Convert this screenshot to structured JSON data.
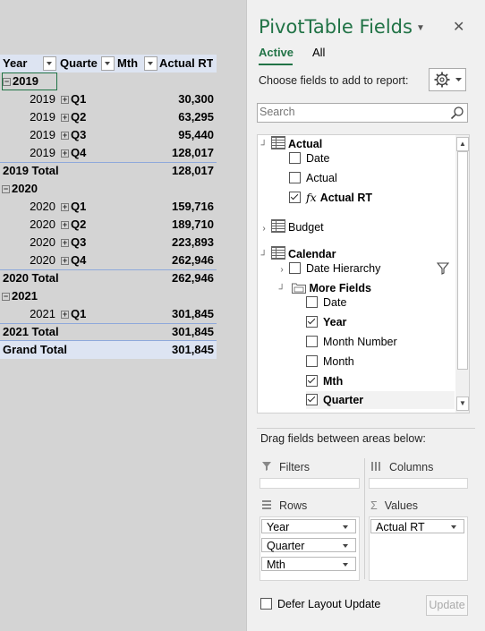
{
  "pivot": {
    "headers": [
      "Year",
      "Quarte",
      "Mth",
      "Actual RT"
    ],
    "rows": [
      {
        "type": "group",
        "label": "2019"
      },
      {
        "type": "detail",
        "year": "2019",
        "quarter": "Q1",
        "value": "30,300"
      },
      {
        "type": "detail",
        "year": "2019",
        "quarter": "Q2",
        "value": "63,295"
      },
      {
        "type": "detail",
        "year": "2019",
        "quarter": "Q3",
        "value": "95,440"
      },
      {
        "type": "detail",
        "year": "2019",
        "quarter": "Q4",
        "value": "128,017"
      },
      {
        "type": "total",
        "label": "2019 Total",
        "value": "128,017"
      },
      {
        "type": "group",
        "label": "2020"
      },
      {
        "type": "detail",
        "year": "2020",
        "quarter": "Q1",
        "value": "159,716"
      },
      {
        "type": "detail",
        "year": "2020",
        "quarter": "Q2",
        "value": "189,710"
      },
      {
        "type": "detail",
        "year": "2020",
        "quarter": "Q3",
        "value": "223,893"
      },
      {
        "type": "detail",
        "year": "2020",
        "quarter": "Q4",
        "value": "262,946"
      },
      {
        "type": "total",
        "label": "2020 Total",
        "value": "262,946"
      },
      {
        "type": "group",
        "label": "2021"
      },
      {
        "type": "detail",
        "year": "2021",
        "quarter": "Q1",
        "value": "301,845"
      },
      {
        "type": "total",
        "label": "2021 Total",
        "value": "301,845"
      }
    ],
    "grand_total": {
      "label": "Grand Total",
      "value": "301,845"
    }
  },
  "pane": {
    "title": "PivotTable Fields",
    "tabs": [
      "Active",
      "All"
    ],
    "choose_label": "Choose fields to add to report:",
    "search_placeholder": "Search",
    "fields": {
      "actual": {
        "label": "Actual",
        "children": [
          {
            "label": "Date",
            "checked": false
          },
          {
            "label": "Actual",
            "checked": false
          },
          {
            "label": "Actual RT",
            "checked": true
          }
        ]
      },
      "budget": {
        "label": "Budget"
      },
      "calendar": {
        "label": "Calendar",
        "date_hierarchy": "Date Hierarchy",
        "more_fields": "More Fields",
        "children": [
          {
            "label": "Date",
            "checked": false
          },
          {
            "label": "Year",
            "checked": true
          },
          {
            "label": "Month Number",
            "checked": false
          },
          {
            "label": "Month",
            "checked": false
          },
          {
            "label": "Mth",
            "checked": true
          },
          {
            "label": "Quarter",
            "checked": true
          }
        ]
      }
    },
    "drag_label": "Drag fields between areas below:",
    "areas": {
      "filters": "Filters",
      "columns": "Columns",
      "rows": "Rows",
      "values": "Values",
      "rows_items": [
        "Year",
        "Quarter",
        "Mth"
      ],
      "values_items": [
        "Actual RT"
      ]
    },
    "defer_label": "Defer Layout Update",
    "update_label": "Update",
    "fx_symbol": "fx",
    "sigma_symbol": "Σ",
    "close_symbol": "✕"
  },
  "colors": {
    "accent": "#217346",
    "header_fill": "#dde4f2",
    "total_line": "#8ea9db"
  }
}
